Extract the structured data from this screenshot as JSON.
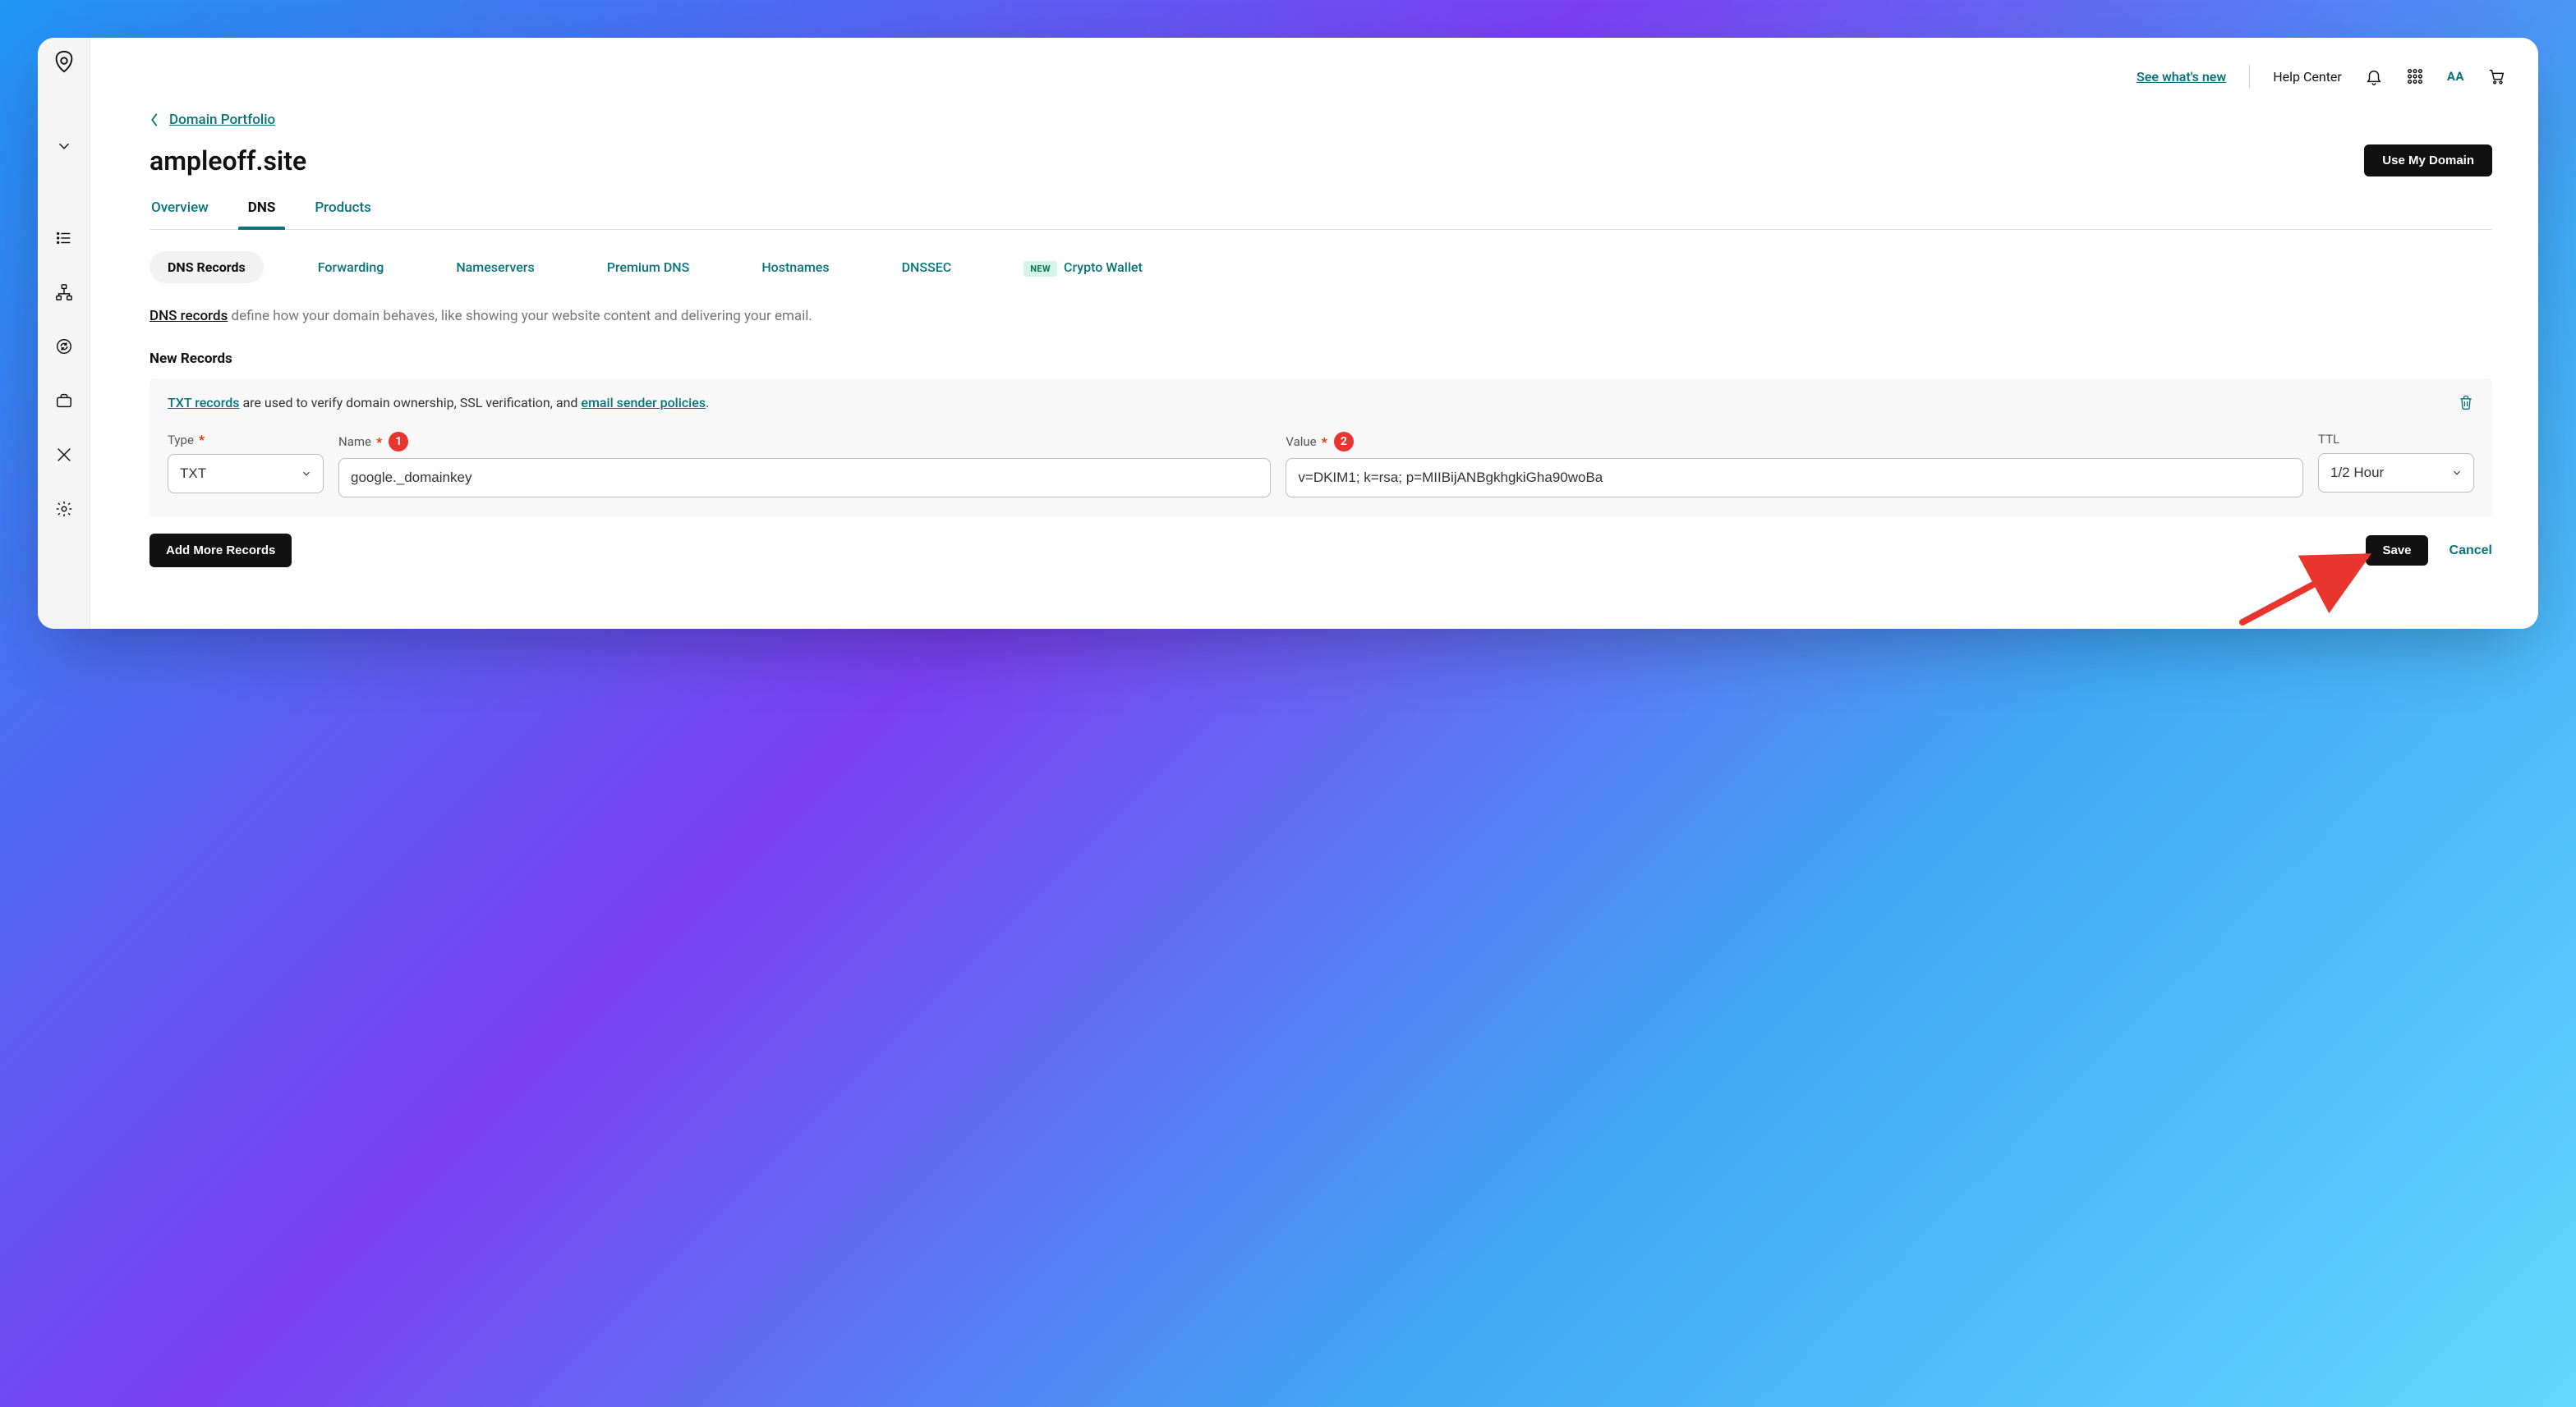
{
  "topbar": {
    "whats_new": "See what's new",
    "help_center": "Help Center",
    "aa": "AA"
  },
  "crumb": {
    "back": "Domain Portfolio"
  },
  "title": "ampleoff.site",
  "use_domain_btn": "Use My Domain",
  "tabs": [
    {
      "label": "Overview",
      "active": false
    },
    {
      "label": "DNS",
      "active": true
    },
    {
      "label": "Products",
      "active": false
    }
  ],
  "subtabs": [
    {
      "label": "DNS Records",
      "active": true
    },
    {
      "label": "Forwarding"
    },
    {
      "label": "Nameservers"
    },
    {
      "label": "Premium DNS"
    },
    {
      "label": "Hostnames"
    },
    {
      "label": "DNSSEC"
    },
    {
      "label": "Crypto Wallet",
      "new": true
    }
  ],
  "new_badge": "NEW",
  "dns_records_link": "DNS records",
  "dns_records_suffix": " define how your domain behaves, like showing your website content and delivering your email.",
  "new_records_heading": "New Records",
  "info": {
    "prefix_link": "TXT records",
    "mid": " are used to verify domain ownership, SSL verification, and ",
    "suffix_link": "email sender policies",
    "end": "."
  },
  "fields": {
    "type_label": "Type",
    "name_label": "Name",
    "value_label": "Value",
    "ttl_label": "TTL",
    "type_value": "TXT",
    "name_value": "google._domainkey",
    "value_value": "v=DKIM1; k=rsa; p=MIIBijANBgkhgkiGha90woBa",
    "ttl_value": "1/2 Hour"
  },
  "badges": {
    "name": "1",
    "value": "2"
  },
  "more_btn": "Add More Records",
  "save_btn": "Save",
  "cancel_btn": "Cancel"
}
